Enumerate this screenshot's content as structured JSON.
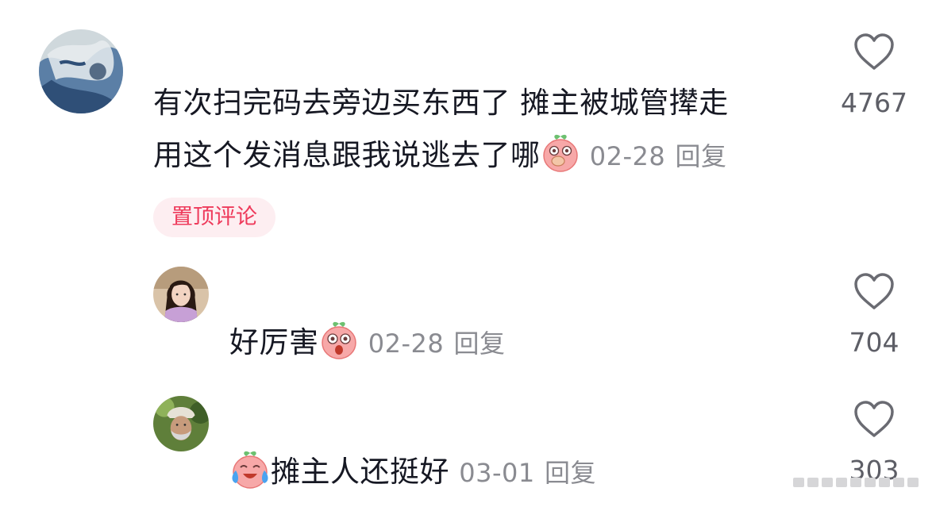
{
  "comments": [
    {
      "text_line1": "有次扫完码去旁边买东西了 摊主被城管撵走",
      "text_line2": "用这个发消息跟我说逃去了哪",
      "emoji": "covering-mouth-peach-emoji",
      "date": "02-28",
      "reply_label": "回复",
      "like_count": "4767",
      "badge": "置顶评论"
    }
  ],
  "replies": [
    {
      "text": "好厉害",
      "emoji": "shocked-peach-emoji",
      "date": "02-28",
      "reply_label": "回复",
      "like_count": "704"
    },
    {
      "text": "摊主人还挺好",
      "emoji": "crying-laughing-peach-emoji",
      "date": "03-01",
      "reply_label": "回复",
      "like_count": "303"
    }
  ],
  "icons": {
    "like": "heart-outline-icon"
  },
  "colors": {
    "text": "#161823",
    "meta": "#8a8b91",
    "badge_bg": "#fdeef1",
    "badge_text": "#ee3a5b"
  }
}
